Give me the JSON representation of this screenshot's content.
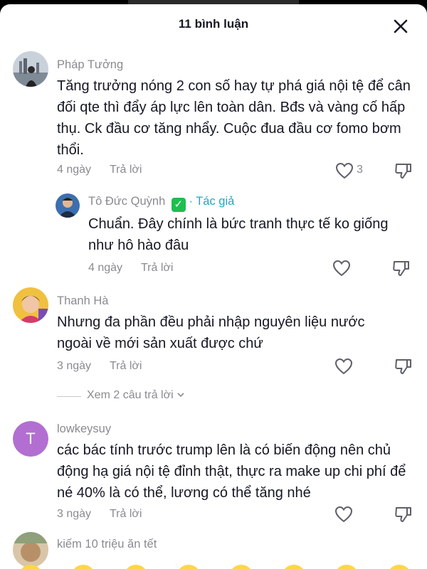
{
  "header": {
    "title": "11 bình luận",
    "close_icon": "close-icon"
  },
  "comments": [
    {
      "username": "Pháp Tưởng",
      "text": "Tăng trưởng nóng 2 con số hay tự phá giá nội tệ để cân đối qte thì đẩy áp lực lên toàn dân. Bđs và vàng cố hấp thụ. Ck đầu cơ tăng nhẩy. Cuộc đua đầu cơ fomo bơm thổi.",
      "time": "4 ngày",
      "reply": "Trả lời",
      "likes": "3"
    },
    {
      "username": "Tô Đức Quỳnh",
      "verified": "✓",
      "author_tag": "· Tác giả",
      "text": "Chuẩn. Đây chính là bức tranh thực tế ko giống như hô hào đâu",
      "time": "4 ngày",
      "reply": "Trả lời"
    },
    {
      "username": "Thanh Hà",
      "text": "Nhưng đa phần đều phải nhập nguyên liệu nước ngoài về mới sản xuất được chứ",
      "time": "3 ngày",
      "reply": "Trả lời",
      "view_replies": "Xem 2 câu trả lời"
    },
    {
      "username": "lowkeysuy",
      "avatar_letter": "T",
      "text": "các bác tính trước trump lên là có biến động nên chủ động hạ giá nội tệ đỉnh thật, thực ra make up chi phí để né 40% là có thể, lương có thể tăng nhé",
      "time": "3 ngày",
      "reply": "Trả lời"
    },
    {
      "username": "kiếm 10 triệu ăn tết"
    }
  ],
  "colors": {
    "muted": "#8a8b91",
    "author_tag": "#20a6c4",
    "verified": "#1fbe4f",
    "letter_avatar": "#b26fd1"
  }
}
